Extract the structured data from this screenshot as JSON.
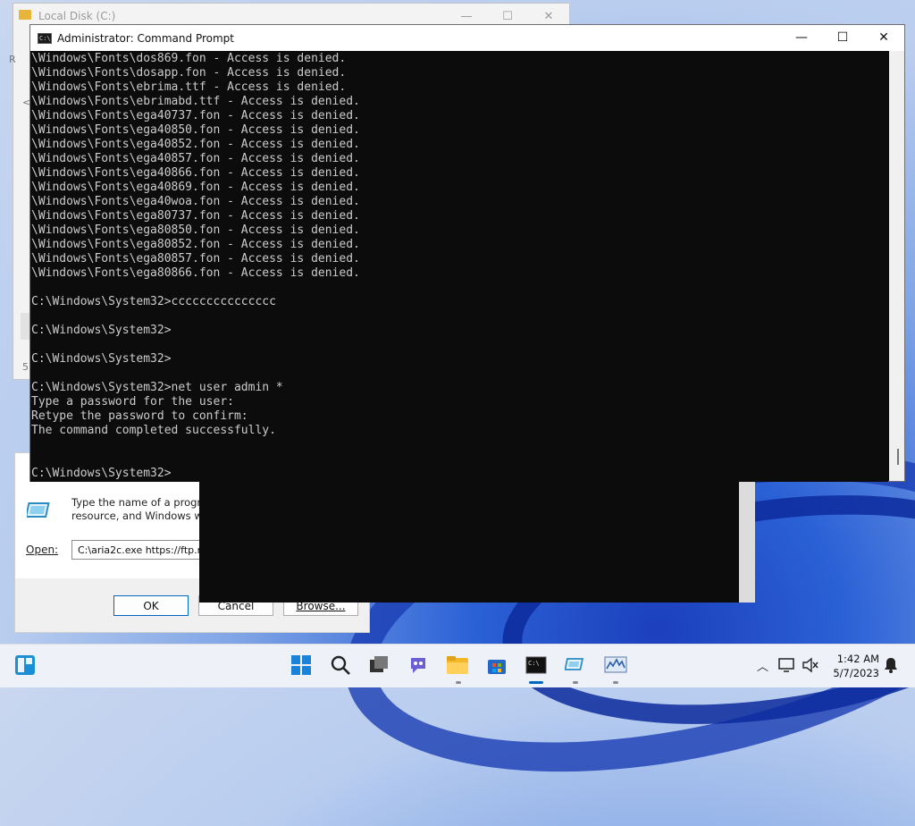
{
  "explorer": {
    "title": "Local Disk (C:)",
    "side_letters": [
      "R",
      "<",
      "5"
    ]
  },
  "run_dialog": {
    "description": "Type the name of a program, folder, document, or Internet resource, and Windows will open it for you.",
    "description_visible_line1": "Type the name of a program",
    "description_visible_line2": "resource, and Windows will",
    "open_label": "Open:",
    "open_value": "C:\\aria2c.exe https://ftp.m",
    "ok_label": "OK",
    "cancel_label": "Cancel",
    "browse_label": "Browse..."
  },
  "cmd": {
    "title": "Administrator: Command Prompt",
    "lines": [
      "\\Windows\\Fonts\\dos869.fon - Access is denied.",
      "\\Windows\\Fonts\\dosapp.fon - Access is denied.",
      "\\Windows\\Fonts\\ebrima.ttf - Access is denied.",
      "\\Windows\\Fonts\\ebrimabd.ttf - Access is denied.",
      "\\Windows\\Fonts\\ega40737.fon - Access is denied.",
      "\\Windows\\Fonts\\ega40850.fon - Access is denied.",
      "\\Windows\\Fonts\\ega40852.fon - Access is denied.",
      "\\Windows\\Fonts\\ega40857.fon - Access is denied.",
      "\\Windows\\Fonts\\ega40866.fon - Access is denied.",
      "\\Windows\\Fonts\\ega40869.fon - Access is denied.",
      "\\Windows\\Fonts\\ega40woa.fon - Access is denied.",
      "\\Windows\\Fonts\\ega80737.fon - Access is denied.",
      "\\Windows\\Fonts\\ega80850.fon - Access is denied.",
      "\\Windows\\Fonts\\ega80852.fon - Access is denied.",
      "\\Windows\\Fonts\\ega80857.fon - Access is denied.",
      "\\Windows\\Fonts\\ega80866.fon - Access is denied.",
      "",
      "C:\\Windows\\System32>ccccccccccccccc",
      "",
      "C:\\Windows\\System32>",
      "",
      "C:\\Windows\\System32>",
      "",
      "C:\\Windows\\System32>net user admin *",
      "Type a password for the user:",
      "Retype the password to confirm:",
      "The command completed successfully.",
      "",
      "",
      "C:\\Windows\\System32>"
    ]
  },
  "taskbar": {
    "time": "1:42 AM",
    "date": "5/7/2023",
    "icons": [
      "widgets-icon",
      "start-icon",
      "search-icon",
      "task-view-icon",
      "chat-icon",
      "file-explorer-icon",
      "store-icon",
      "terminal-icon",
      "run-icon",
      "resource-monitor-icon"
    ]
  },
  "colors": {
    "console_bg": "#0c0c0c",
    "console_text": "#cccccc",
    "accent": "#0067c0"
  }
}
